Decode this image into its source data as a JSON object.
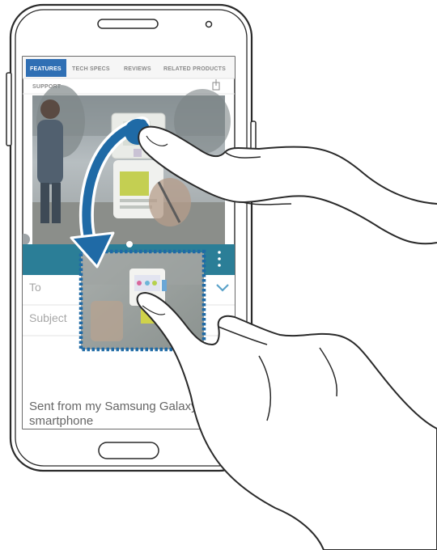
{
  "browser": {
    "tabs": [
      {
        "label": "FEATURES",
        "active": true
      },
      {
        "label": "TECH SPECS",
        "active": false
      },
      {
        "label": "REVIEWS",
        "active": false
      },
      {
        "label": "RELATED PRODUCTS",
        "active": false
      }
    ],
    "support_label": "SUPPORT",
    "accent_color": "#2f6fb4"
  },
  "email": {
    "to_label": "To",
    "subject_label": "Subject",
    "signature_line1": "Sent from my Samsung Galaxy",
    "signature_line2": "smartphone",
    "bar_color": "#2b7e97"
  },
  "gesture": {
    "arrow_color": "#1f6aa6",
    "drop_frame_color": "#1f6aa6"
  }
}
